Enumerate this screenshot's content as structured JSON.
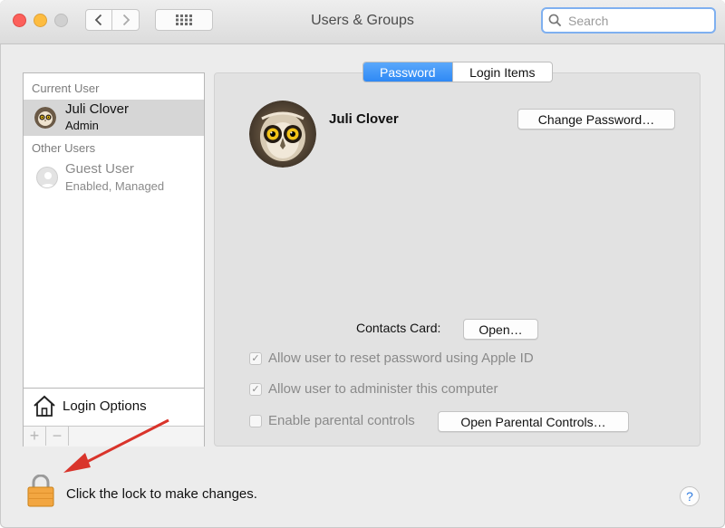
{
  "window": {
    "title": "Users & Groups",
    "search_placeholder": "Search"
  },
  "sidebar": {
    "current_user_header": "Current User",
    "current_user": {
      "name": "Juli Clover",
      "role": "Admin"
    },
    "other_users_header": "Other Users",
    "other_users": [
      {
        "name": "Guest User",
        "status": "Enabled, Managed"
      }
    ],
    "login_options_label": "Login Options",
    "add_label": "+",
    "remove_label": "−"
  },
  "tabs": [
    {
      "label": "Password",
      "active": true
    },
    {
      "label": "Login Items",
      "active": false
    }
  ],
  "main": {
    "user_full_name": "Juli Clover",
    "change_password_label": "Change Password…",
    "contacts_card_label": "Contacts Card:",
    "open_label": "Open…",
    "checkboxes": [
      {
        "label": "Allow user to reset password using Apple ID",
        "checked": true
      },
      {
        "label": "Allow user to administer this computer",
        "checked": true
      },
      {
        "label": "Enable parental controls",
        "checked": false
      }
    ],
    "open_parental_controls_label": "Open Parental Controls…"
  },
  "footer": {
    "lock_text": "Click the lock to make changes.",
    "help_label": "?"
  },
  "colors": {
    "accent": "#2f89f5",
    "annotation_arrow": "#d9342b",
    "lock": "#f2a641"
  }
}
